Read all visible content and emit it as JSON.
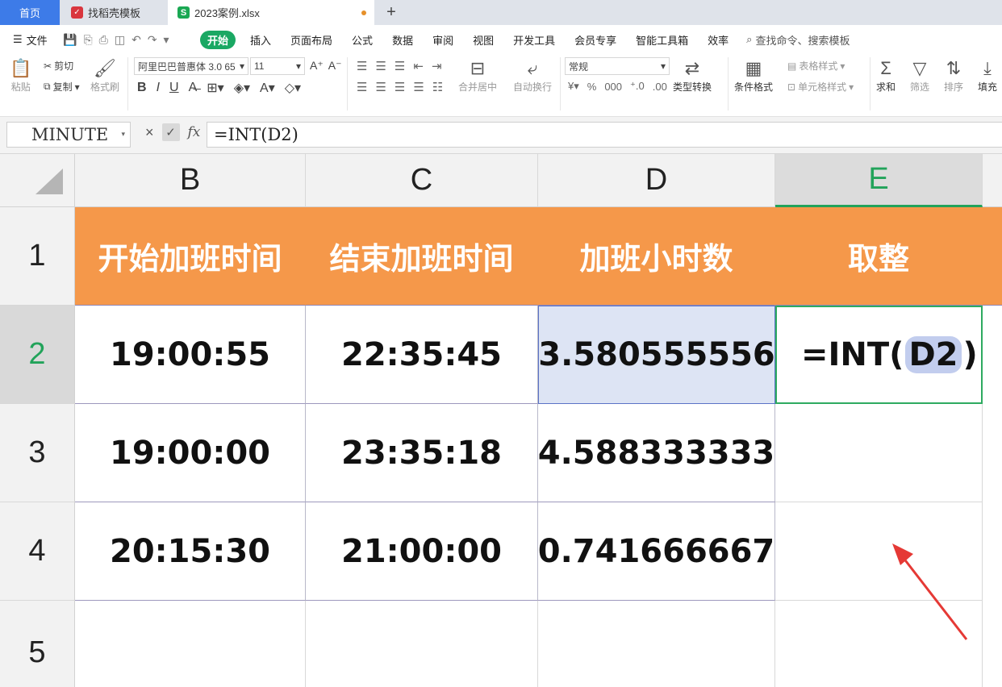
{
  "tabs": {
    "home": "首页",
    "template": "找稻壳模板",
    "file": "2023案例.xlsx",
    "add": "+"
  },
  "menu": {
    "file": "文件",
    "items": [
      "开始",
      "插入",
      "页面布局",
      "公式",
      "数据",
      "审阅",
      "视图",
      "开发工具",
      "会员专享",
      "智能工具箱",
      "效率"
    ],
    "search": "查找命令、搜索模板"
  },
  "toolbar": {
    "paste": "粘贴",
    "cut": "剪切",
    "copy": "复制",
    "format_painter": "格式刷",
    "font_name": "阿里巴巴普惠体 3.0 65",
    "font_size": "11",
    "merge_center": "合并居中",
    "wrap_text": "自动换行",
    "number_format": "常规",
    "type_convert": "类型转换",
    "cond_format": "条件格式",
    "table_style": "表格样式",
    "cell_style": "单元格样式",
    "sum": "求和",
    "filter": "筛选",
    "sort": "排序",
    "fill": "填充"
  },
  "formula_bar": {
    "name_box": "MINUTE",
    "cancel": "×",
    "confirm": "✓",
    "fx": "fx",
    "formula": "=INT(D2)"
  },
  "columns": [
    "B",
    "C",
    "D",
    "E"
  ],
  "rows": [
    "1",
    "2",
    "3",
    "4",
    "5"
  ],
  "table": {
    "headers": [
      "开始加班时间",
      "结束加班时间",
      "加班小时数",
      "取整"
    ],
    "data": [
      [
        "19:00:55",
        "22:35:45",
        "3.580555556"
      ],
      [
        "19:00:00",
        "23:35:18",
        "4.588333333"
      ],
      [
        "20:15:30",
        "21:00:00",
        "0.741666667"
      ]
    ],
    "editing_cell": {
      "prefix": "=INT(",
      "ref": "D2",
      "suffix": ")"
    }
  },
  "colors": {
    "header_fill": "#f5984a",
    "active_green": "#22a35a",
    "ref_highlight": "#dde4f4",
    "annotation_arrow": "#e53935"
  }
}
